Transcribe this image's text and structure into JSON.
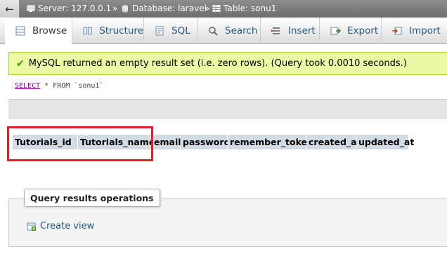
{
  "breadcrumb": {
    "back_icon": "arrow-left-icon",
    "server_label": "Server: 127.0.0.1",
    "database_label": "Database: laravel",
    "table_label": "Table: sonu1",
    "separator": "»"
  },
  "tabs": [
    {
      "label": "Browse",
      "icon": "browse-icon",
      "active": true
    },
    {
      "label": "Structure",
      "icon": "structure-icon",
      "active": false
    },
    {
      "label": "SQL",
      "icon": "sql-icon",
      "active": false
    },
    {
      "label": "Search",
      "icon": "search-icon",
      "active": false
    },
    {
      "label": "Insert",
      "icon": "insert-icon",
      "active": false
    },
    {
      "label": "Export",
      "icon": "export-icon",
      "active": false
    },
    {
      "label": "Import",
      "icon": "import-icon",
      "active": false
    }
  ],
  "message": {
    "icon": "check-icon",
    "text": "MySQL returned an empty result set (i.e. zero rows). (Query took 0.0010 seconds.)"
  },
  "query": {
    "keyword": "SELECT",
    "rest": " * FROM `sonu1`"
  },
  "columns": [
    "Tutorials_id",
    "Tutorials_name",
    "email",
    "password",
    "remember_token",
    "created_at",
    "updated_at"
  ],
  "operations": {
    "legend": "Query results operations",
    "create_view_label": "Create view",
    "create_view_icon": "create-view-icon"
  },
  "colors": {
    "link": "#235a81",
    "success_bg": "#ebf8a4",
    "highlight": "#e1202a",
    "header_bg": "#d3dce3"
  }
}
